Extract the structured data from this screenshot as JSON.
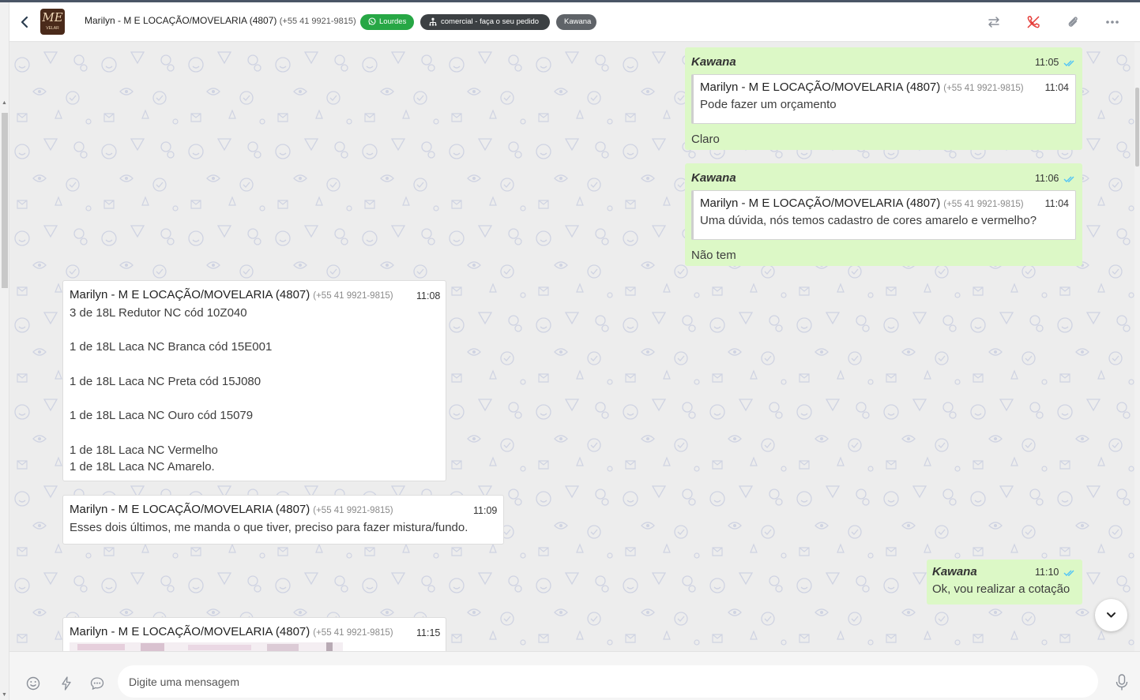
{
  "header": {
    "contact_name": "Marilyn - M E LOCAÇÃO/MOVELARIA (4807)",
    "contact_phone": "(+55 41 9921-9815)",
    "avatar_logo": "ME",
    "avatar_logo_sub": "VELAR",
    "tags": [
      {
        "label": "Lourdes",
        "color": "#27a745",
        "icon": "whatsapp-icon"
      },
      {
        "label": "comercial - faça o seu pedido",
        "color": "#3c4043",
        "icon": "team-icon"
      },
      {
        "label": "Kawana",
        "color": "#5f6368"
      }
    ],
    "actions": [
      "transfer-icon",
      "end-call-icon",
      "attach-icon",
      "more-icon"
    ]
  },
  "messages": [
    {
      "direction": "out",
      "sender": "Kawana",
      "time": "11:05",
      "quote": {
        "name": "Marilyn - M E LOCAÇÃO/MOVELARIA (4807)",
        "phone": "(+55 41 9921-9815)",
        "time": "11:04",
        "text": "Pode fazer um orçamento"
      },
      "text": "Claro"
    },
    {
      "direction": "out",
      "sender": "Kawana",
      "time": "11:06",
      "quote": {
        "name": "Marilyn - M E LOCAÇÃO/MOVELARIA (4807)",
        "phone": "(+55 41 9921-9815)",
        "time": "11:04",
        "text": "Uma dúvida, nós temos cadastro de cores amarelo e vermelho?"
      },
      "text": "Não tem"
    },
    {
      "direction": "in",
      "name": "Marilyn - M E LOCAÇÃO/MOVELARIA (4807)",
      "phone": "(+55 41 9921-9815)",
      "time": "11:08",
      "lines": [
        "3 de 18L Redutor NC cód 10Z040",
        "",
        "1 de 18L Laca NC Branca cód 15E001",
        "",
        "1 de 18L Laca NC Preta cód 15J080",
        "",
        "1 de 18L Laca NC Ouro cód 15079",
        "",
        "1 de 18L Laca NC Vermelho",
        "1 de 18L Laca NC Amarelo."
      ]
    },
    {
      "direction": "in",
      "name": "Marilyn - M E LOCAÇÃO/MOVELARIA (4807)",
      "phone": "(+55 41 9921-9815)",
      "time": "11:09",
      "text": "Esses dois últimos, me manda o que tiver, preciso para fazer mistura/fundo."
    },
    {
      "direction": "out",
      "sender": "Kawana",
      "time": "11:10",
      "text": "Ok, vou realizar a cotação"
    },
    {
      "direction": "in",
      "name": "Marilyn - M E LOCAÇÃO/MOVELARIA (4807)",
      "phone": "(+55 41 9921-9815)",
      "time": "11:15",
      "media": "blurred-image"
    }
  ],
  "composer": {
    "placeholder": "Digite uma mensagem",
    "icons": [
      "emoji-icon",
      "quick-reply-icon",
      "chat-bubble-icon",
      "mic-icon"
    ]
  },
  "colors": {
    "outgoing_bubble": "#dcf8c6",
    "incoming_bubble": "#ffffff",
    "read_ticks": "#4fc3f7",
    "chat_background": "#ededed"
  }
}
